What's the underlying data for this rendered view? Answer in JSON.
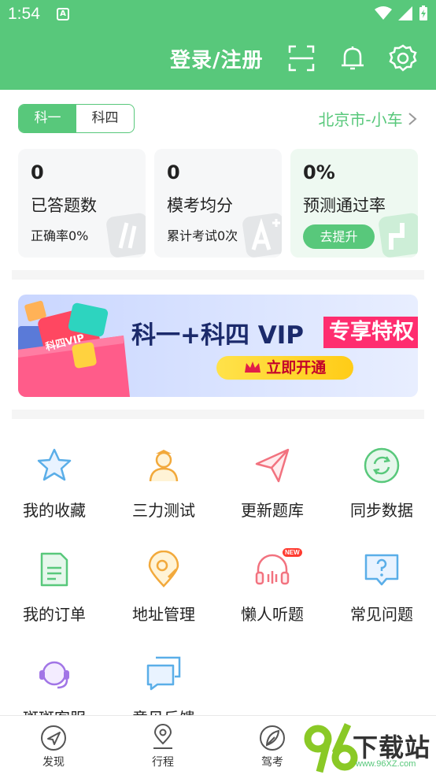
{
  "status_bar": {
    "time": "1:54",
    "notif_letter": "A"
  },
  "header": {
    "title": "登录/注册",
    "colors": {
      "brand": "#58c87b"
    }
  },
  "subject_tabs": [
    {
      "label": "科一",
      "active": true
    },
    {
      "label": "科四",
      "active": false
    }
  ],
  "location": "北京市-小车",
  "stats": [
    {
      "value": "0",
      "label": "已答题数",
      "sub": "正确率0%"
    },
    {
      "value": "0",
      "label": "模考均分",
      "sub": "累计考试0次"
    },
    {
      "value": "0%",
      "label": "预测通过率",
      "button": "去提升"
    }
  ],
  "banner": {
    "title": "科一+科四 VIP",
    "tag": "专享特权",
    "button": "立即开通",
    "card_text": "科四VIP"
  },
  "grid": [
    {
      "label": "我的收藏",
      "icon": "star-icon"
    },
    {
      "label": "三力测试",
      "icon": "person-icon"
    },
    {
      "label": "更新题库",
      "icon": "paper-plane-icon"
    },
    {
      "label": "同步数据",
      "icon": "sync-icon"
    },
    {
      "label": "我的订单",
      "icon": "document-icon"
    },
    {
      "label": "地址管理",
      "icon": "location-pin-icon"
    },
    {
      "label": "懒人听题",
      "icon": "headphones-icon",
      "badge": "NEW"
    },
    {
      "label": "常见问题",
      "icon": "question-icon"
    },
    {
      "label": "斑斑客服",
      "icon": "headset-icon"
    },
    {
      "label": "意见反馈",
      "icon": "chat-bubbles-icon"
    }
  ],
  "bottom_nav": [
    {
      "label": "发现",
      "icon": "compass-icon"
    },
    {
      "label": "行程",
      "icon": "map-pin-icon"
    },
    {
      "label": "驾考",
      "icon": "leaf-icon"
    }
  ],
  "watermark": {
    "number": "96",
    "text": "下载站",
    "url": "www.96XZ.com"
  }
}
